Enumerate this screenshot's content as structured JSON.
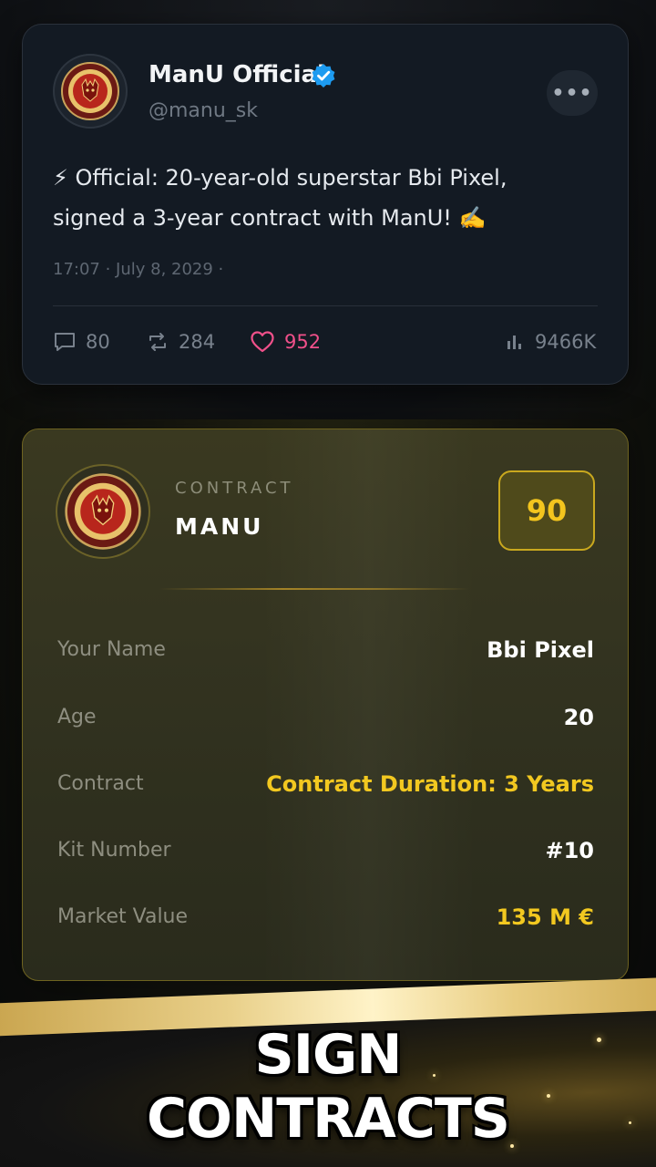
{
  "tweet": {
    "name": "ManU Official",
    "handle": "@manu_sk",
    "text_line1": "⚡ Official: 20-year-old superstar Bbi Pixel,",
    "text_line2": "signed a 3-year contract with ManU! ✍️",
    "timestamp": "17:07 · July 8, 2029 ·",
    "more_label": "•••",
    "stats": {
      "comments": "80",
      "retweets": "284",
      "likes": "952",
      "views": "9466K"
    },
    "colors": {
      "like": "#f0508a",
      "verified": "#1d9bf0"
    }
  },
  "contract": {
    "label": "CONTRACT",
    "club": "MANU",
    "rating": "90",
    "rows": [
      {
        "label": "Your Name",
        "value": "Bbi Pixel"
      },
      {
        "label": "Age",
        "value": "20"
      },
      {
        "label": "Contract",
        "value": "Contract Duration: 3 Years"
      },
      {
        "label": "Kit Number",
        "value": "#10"
      },
      {
        "label": "Market Value",
        "value": "135 M €"
      }
    ],
    "colors": {
      "accent": "#f2c820"
    }
  },
  "banner": {
    "line1": "SIGN",
    "line2": "CONTRACTS"
  },
  "icons": [
    "verified-badge-icon",
    "more-icon",
    "comment-icon",
    "retweet-icon",
    "heart-icon",
    "views-icon",
    "club-crest-icon"
  ]
}
